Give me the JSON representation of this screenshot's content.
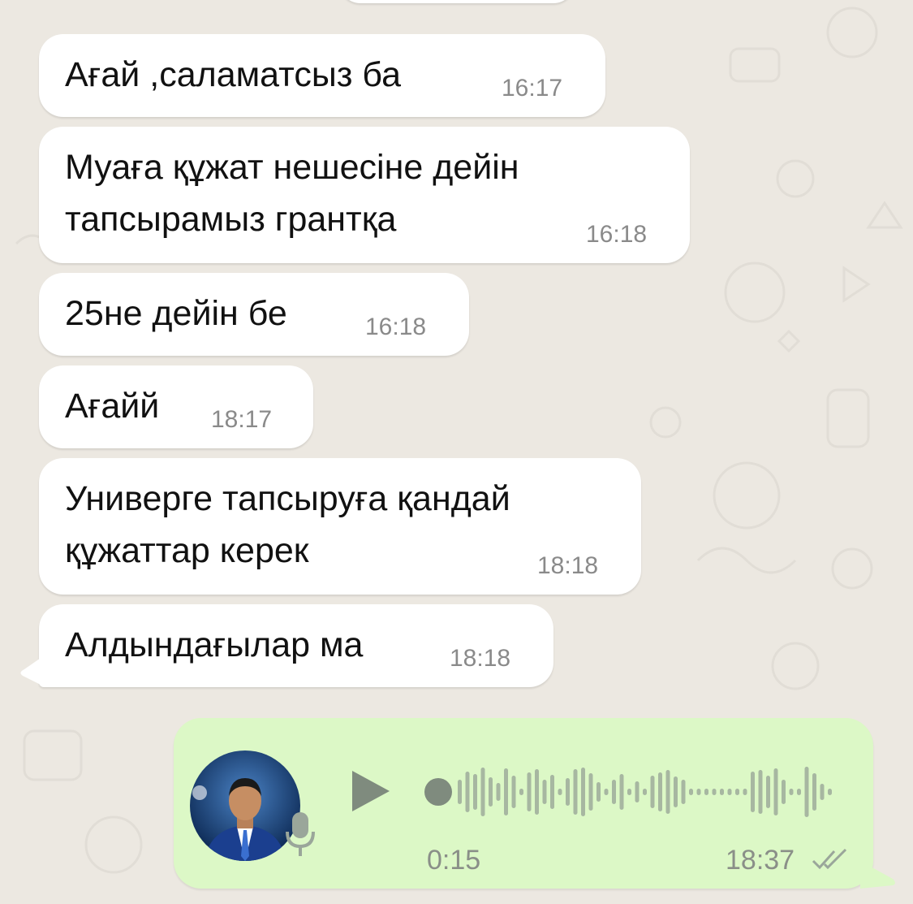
{
  "messages": [
    {
      "lines": "Ағай ,саламатсыз ба",
      "time": "16:17"
    },
    {
      "lines": "Муаға құжат нешесіне дейін\nтапсырамыз грантқа",
      "time": "16:18"
    },
    {
      "lines": "25не дейін бе",
      "time": "16:18"
    },
    {
      "lines": "Ағайй",
      "time": "18:17"
    },
    {
      "lines": "Универге тапсыруға қандай\nқұжаттар керек",
      "time": "18:18"
    },
    {
      "lines": "Алдындағылар ма",
      "time": "18:18"
    }
  ],
  "voice": {
    "duration": "0:15",
    "time": "18:37",
    "status": "read",
    "play_icon": "play-icon",
    "mic_icon": "microphone-icon",
    "ticks_icon": "double-check-icon"
  },
  "colors": {
    "background": "#ece8e1",
    "incoming_bubble": "#ffffff",
    "outgoing_bubble": "#dcf8c6",
    "meta_text": "#8a8a8a",
    "waveform": "#a7b7a1"
  }
}
